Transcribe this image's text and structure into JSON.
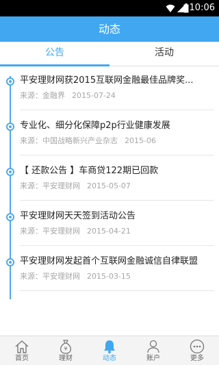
{
  "status_bar": {
    "time": "10:06"
  },
  "header": {
    "title": "动态"
  },
  "tabs": [
    {
      "label": "公告",
      "active": true
    },
    {
      "label": "活动",
      "active": false
    }
  ],
  "news": [
    {
      "title": "平安理财网获2015互联网金融最佳品牌奖...",
      "source": "来源：金融界",
      "date": "2015-07-24"
    },
    {
      "title": "专业化、细分化保障p2p行业健康发展",
      "source": "来源：中国战略新兴产业杂志",
      "date": "2015-06"
    },
    {
      "title": "【 还款公告 】车商贷122期已回款",
      "source": "来源：平安理财网",
      "date": "2015-05-07"
    },
    {
      "title": "平安理财网天天签到活动公告",
      "source": "来源：平安理财网",
      "date": "2015-04-21"
    },
    {
      "title": "平安理财网发起首个互联网金融诚信自律联盟",
      "source": "来源：平安理财网",
      "date": "2015-03-15"
    }
  ],
  "bottom_nav": [
    {
      "label": "首页",
      "icon": "home-icon",
      "active": false
    },
    {
      "label": "理财",
      "icon": "money-bag-icon",
      "active": false
    },
    {
      "label": "动态",
      "icon": "bell-icon",
      "active": true
    },
    {
      "label": "账户",
      "icon": "user-icon",
      "active": false
    },
    {
      "label": "更多",
      "icon": "more-icon",
      "active": false
    }
  ],
  "colors": {
    "accent": "#41a7f1",
    "timeline": "#4ea9eb",
    "text": "#222222",
    "meta_text": "#a6a6a6"
  }
}
